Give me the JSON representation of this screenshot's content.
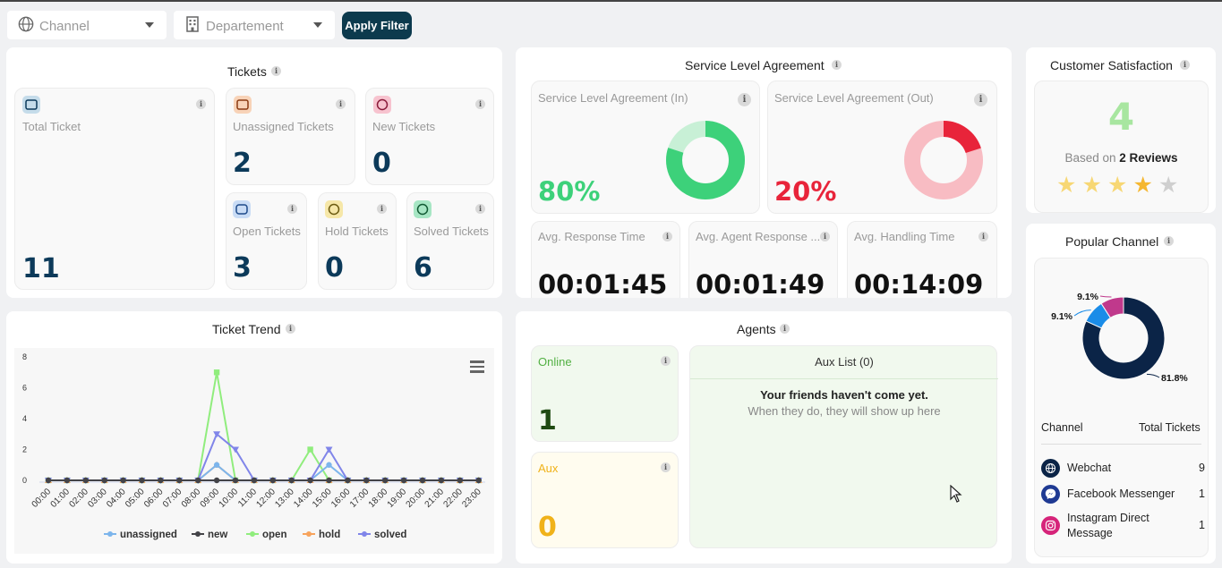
{
  "filters": {
    "channel_placeholder": "Channel",
    "department_placeholder": "Departement",
    "apply_label": "Apply Filter"
  },
  "tickets": {
    "title": "Tickets",
    "total": {
      "label": "Total Ticket",
      "value": "11"
    },
    "unassigned": {
      "label": "Unassigned Tickets",
      "value": "2"
    },
    "new": {
      "label": "New Tickets",
      "value": "0"
    },
    "open": {
      "label": "Open Tickets",
      "value": "3"
    },
    "hold": {
      "label": "Hold Tickets",
      "value": "0"
    },
    "solved": {
      "label": "Solved Tickets",
      "value": "6"
    }
  },
  "sla": {
    "title": "Service Level Agreement",
    "in": {
      "label": "Service Level Agreement (In)",
      "value": "80%",
      "fraction": 0.8,
      "color": "#3dd17a",
      "track": "#c8f0d6"
    },
    "out": {
      "label": "Service Level Agreement (Out)",
      "value": "20%",
      "fraction": 0.2,
      "color": "#e8243a",
      "track": "#f8bcc3"
    },
    "avg_response": {
      "label": "Avg. Response Time",
      "value": "00:01:45"
    },
    "avg_agent_response": {
      "label": "Avg. Agent Response ...",
      "value": "00:01:49"
    },
    "avg_handling": {
      "label": "Avg. Handling Time",
      "value": "00:14:09"
    }
  },
  "satisfaction": {
    "title": "Customer Satisfaction",
    "score": "4",
    "based_on_prefix": "Based on",
    "reviews": "2 Reviews",
    "rating": 4,
    "max_rating": 5
  },
  "trend": {
    "title": "Ticket Trend",
    "menu_icon": "hamburger-menu-icon"
  },
  "chart_data": {
    "type": "line",
    "title": "Ticket Trend",
    "x": [
      "00:00",
      "01:00",
      "02:00",
      "03:00",
      "04:00",
      "05:00",
      "06:00",
      "07:00",
      "08:00",
      "09:00",
      "10:00",
      "11:00",
      "12:00",
      "13:00",
      "14:00",
      "15:00",
      "16:00",
      "17:00",
      "18:00",
      "19:00",
      "20:00",
      "21:00",
      "22:00",
      "23:00"
    ],
    "ylim": [
      0,
      8
    ],
    "yticks": [
      0,
      2,
      4,
      6,
      8
    ],
    "grid": false,
    "legend": "bottom",
    "series": [
      {
        "name": "unassigned",
        "color": "#7cb5ec",
        "values": [
          0,
          0,
          0,
          0,
          0,
          0,
          0,
          0,
          0,
          1,
          0,
          0,
          0,
          0,
          0,
          1,
          0,
          0,
          0,
          0,
          0,
          0,
          0,
          0
        ]
      },
      {
        "name": "new",
        "color": "#434348",
        "values": [
          0,
          0,
          0,
          0,
          0,
          0,
          0,
          0,
          0,
          0,
          0,
          0,
          0,
          0,
          0,
          0,
          0,
          0,
          0,
          0,
          0,
          0,
          0,
          0
        ]
      },
      {
        "name": "open",
        "color": "#90ed7d",
        "values": [
          0,
          0,
          0,
          0,
          0,
          0,
          0,
          0,
          0,
          7,
          0,
          0,
          0,
          0,
          2,
          0,
          0,
          0,
          0,
          0,
          0,
          0,
          0,
          0
        ]
      },
      {
        "name": "hold",
        "color": "#f7a35c",
        "values": [
          0,
          0,
          0,
          0,
          0,
          0,
          0,
          0,
          0,
          1,
          0,
          0,
          0,
          0,
          0,
          0,
          0,
          0,
          0,
          0,
          0,
          0,
          0,
          0
        ]
      },
      {
        "name": "solved",
        "color": "#8085e9",
        "values": [
          0,
          0,
          0,
          0,
          0,
          0,
          0,
          0,
          0,
          3,
          2,
          0,
          0,
          0,
          0,
          2,
          0,
          0,
          0,
          0,
          0,
          0,
          0,
          0
        ]
      }
    ]
  },
  "agents": {
    "title": "Agents",
    "online": {
      "label": "Online",
      "value": "1"
    },
    "aux": {
      "label": "Aux",
      "value": "0"
    },
    "aux_list_title": "Aux List (0)",
    "empty_title": "Your friends haven't come yet.",
    "empty_sub": "When they do, they will show up here"
  },
  "popular": {
    "title": "Popular Channel",
    "col_channel": "Channel",
    "col_total": "Total Tickets",
    "donut": [
      {
        "label": "81.8%",
        "value": 81.8,
        "color": "#0b2447"
      },
      {
        "label": "9.1%",
        "value": 9.1,
        "color": "#1a8ce8"
      },
      {
        "label": "9.1%",
        "value": 9.1,
        "color": "#c0398c"
      }
    ],
    "rows": [
      {
        "name": "Webchat",
        "value": "9",
        "icon": "globe-icon",
        "color": "#0b2447"
      },
      {
        "name": "Facebook Messenger",
        "value": "1",
        "icon": "messenger-icon",
        "color": "#1f3a93"
      },
      {
        "name": "Instagram Direct Message",
        "value": "1",
        "icon": "instagram-icon",
        "color": "#d6247a"
      }
    ]
  }
}
